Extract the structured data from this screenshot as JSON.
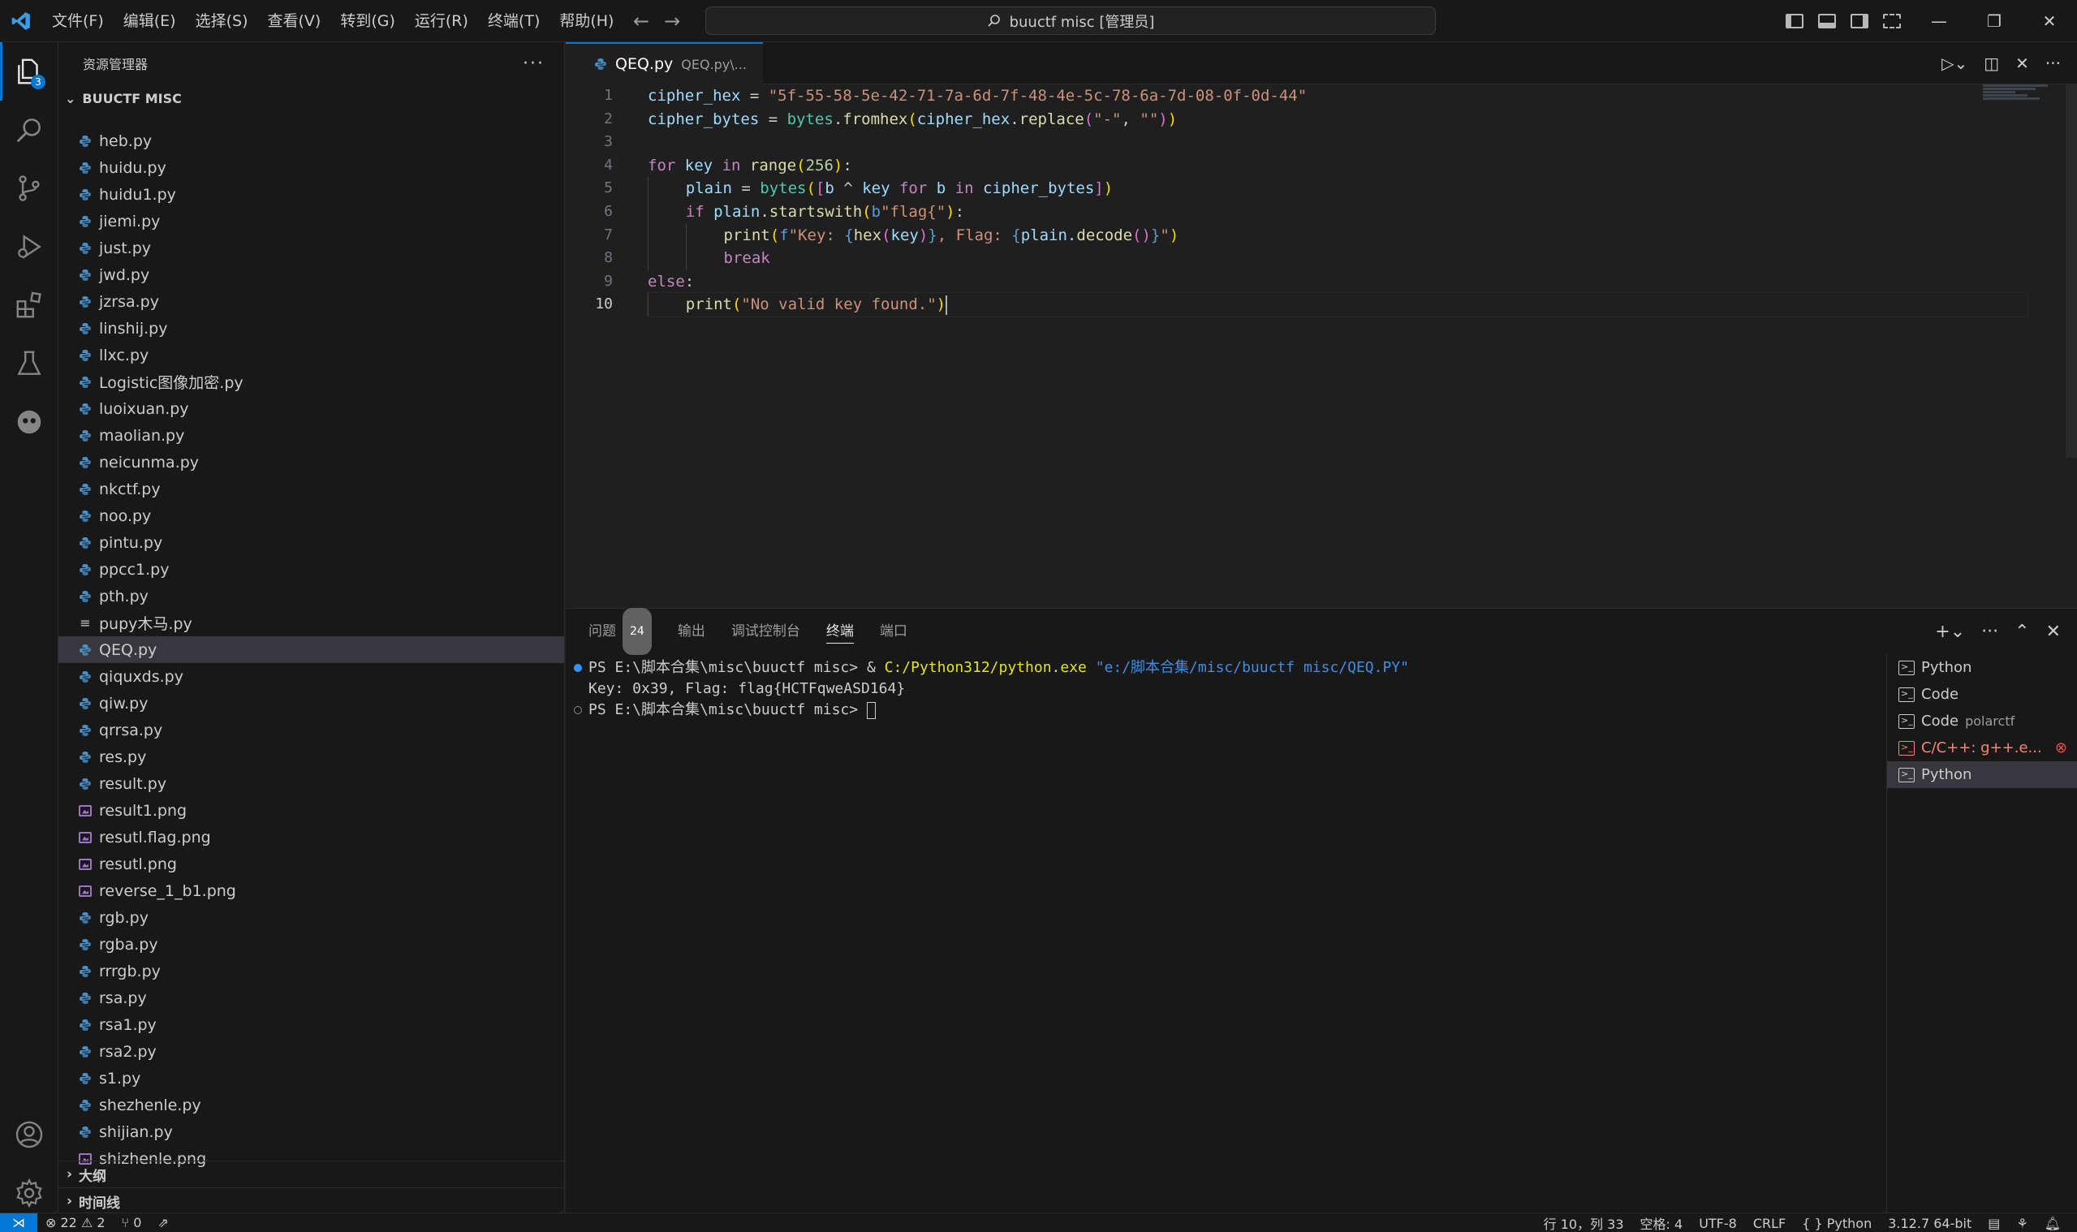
{
  "titlebar": {
    "menu": [
      "文件(F)",
      "编辑(E)",
      "选择(S)",
      "查看(V)",
      "转到(G)",
      "运行(R)",
      "终端(T)",
      "帮助(H)"
    ],
    "search_text": "buuctf misc [管理员]"
  },
  "activitybar": {
    "explorer_badge": "3"
  },
  "sidebar": {
    "title": "资源管理器",
    "more": "···",
    "folder": "BUUCTF MISC",
    "files": [
      {
        "name": "heb.py",
        "type": "py"
      },
      {
        "name": "huidu.py",
        "type": "py"
      },
      {
        "name": "huidu1.py",
        "type": "py"
      },
      {
        "name": "jiemi.py",
        "type": "py"
      },
      {
        "name": "just.py",
        "type": "py"
      },
      {
        "name": "jwd.py",
        "type": "py"
      },
      {
        "name": "jzrsa.py",
        "type": "py"
      },
      {
        "name": "linshij.py",
        "type": "py"
      },
      {
        "name": "llxc.py",
        "type": "py"
      },
      {
        "name": "Logistic图像加密.py",
        "type": "py"
      },
      {
        "name": "luoixuan.py",
        "type": "py"
      },
      {
        "name": "maolian.py",
        "type": "py"
      },
      {
        "name": "neicunma.py",
        "type": "py"
      },
      {
        "name": "nkctf.py",
        "type": "py"
      },
      {
        "name": "noo.py",
        "type": "py"
      },
      {
        "name": "pintu.py",
        "type": "py"
      },
      {
        "name": "ppcc1.py",
        "type": "py"
      },
      {
        "name": "pth.py",
        "type": "py"
      },
      {
        "name": "pupy木马.py",
        "type": "txt"
      },
      {
        "name": "QEQ.py",
        "type": "py",
        "selected": true
      },
      {
        "name": "qiquxds.py",
        "type": "py"
      },
      {
        "name": "qiw.py",
        "type": "py"
      },
      {
        "name": "qrrsa.py",
        "type": "py"
      },
      {
        "name": "res.py",
        "type": "py"
      },
      {
        "name": "result.py",
        "type": "py"
      },
      {
        "name": "result1.png",
        "type": "png"
      },
      {
        "name": "resutl.flag.png",
        "type": "png"
      },
      {
        "name": "resutl.png",
        "type": "png"
      },
      {
        "name": "reverse_1_b1.png",
        "type": "png"
      },
      {
        "name": "rgb.py",
        "type": "py"
      },
      {
        "name": "rgba.py",
        "type": "py"
      },
      {
        "name": "rrrgb.py",
        "type": "py"
      },
      {
        "name": "rsa.py",
        "type": "py"
      },
      {
        "name": "rsa1.py",
        "type": "py"
      },
      {
        "name": "rsa2.py",
        "type": "py"
      },
      {
        "name": "s1.py",
        "type": "py"
      },
      {
        "name": "shezhenle.py",
        "type": "py"
      },
      {
        "name": "shijian.py",
        "type": "py"
      },
      {
        "name": "shizhenle.png",
        "type": "png"
      }
    ],
    "outline": "大纲",
    "timeline": "时间线"
  },
  "editor": {
    "tab_name": "QEQ.py",
    "tab_desc": "QEQ.py\\...",
    "line_numbers": [
      "1",
      "2",
      "3",
      "4",
      "5",
      "6",
      "7",
      "8",
      "9",
      "10"
    ],
    "current_line": "10"
  },
  "panel": {
    "tabs": [
      "问题",
      "输出",
      "调试控制台",
      "终端",
      "端口"
    ],
    "problems_count": "24",
    "terminal_lines": {
      "l1_prompt": "PS E:\\脚本合集\\misc\\buuctf misc> ",
      "l1_amp": "& ",
      "l1_exe": "C:/Python312/python.exe",
      "l1_arg": " \"e:/脚本合集/misc/buuctf misc/QEQ.PY\"",
      "l2": "Key: 0x39, Flag: flag{HCTFqweASD164}",
      "l3_prompt": "PS E:\\脚本合集\\misc\\buuctf misc> "
    },
    "terminals": [
      {
        "name": "Python",
        "desc": ""
      },
      {
        "name": "Code",
        "desc": ""
      },
      {
        "name": "Code",
        "desc": "polarctf"
      },
      {
        "name": "C/C++: g++.e...",
        "desc": ""
      },
      {
        "name": "Python",
        "desc": ""
      }
    ]
  },
  "statusbar": {
    "errors": "⊗ 22 ⚠ 2",
    "ports": "⑂ 0",
    "position": "行 10，列 33",
    "spaces": "空格: 4",
    "encoding": "UTF-8",
    "eol": "CRLF",
    "language": "{ } Python",
    "interpreter": "3.12.7 64-bit"
  },
  "colors": {
    "accent": "#0078d4",
    "background": "#1f1f1f",
    "sidebar": "#181818",
    "python_icon": "#4a90c8"
  }
}
